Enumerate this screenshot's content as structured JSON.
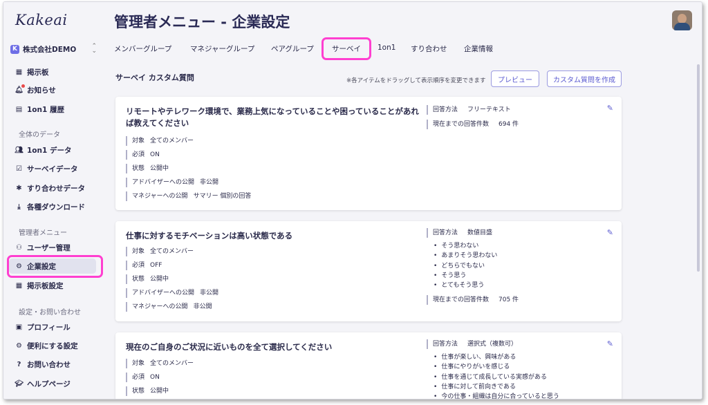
{
  "sidebar": {
    "logo": "Kakeai",
    "company": "株式会社DEMO",
    "items_top": [
      {
        "label": "掲示板",
        "icon": "board-icon"
      },
      {
        "label": "お知らせ",
        "icon": "bell-icon"
      },
      {
        "label": "1on1 履歴",
        "icon": "history-icon"
      }
    ],
    "section_data": "全体のデータ",
    "items_data": [
      {
        "label": "1on1 データ",
        "icon": "people-icon"
      },
      {
        "label": "サーベイデータ",
        "icon": "survey-icon"
      },
      {
        "label": "すり合わせデータ",
        "icon": "puzzle-icon"
      },
      {
        "label": "各種ダウンロード",
        "icon": "download-icon"
      }
    ],
    "section_admin": "管理者メニュー",
    "items_admin": [
      {
        "label": "ユーザー管理",
        "icon": "user-manage-icon"
      },
      {
        "label": "企業設定",
        "icon": "company-settings-icon",
        "active": true
      },
      {
        "label": "掲示板設定",
        "icon": "board-settings-icon"
      }
    ],
    "section_settings": "設定・お問い合わせ",
    "items_settings": [
      {
        "label": "プロフィール",
        "icon": "profile-icon"
      },
      {
        "label": "便利にする設定",
        "icon": "gear-icon"
      },
      {
        "label": "お問い合わせ",
        "icon": "help-circle-icon"
      },
      {
        "label": "ヘルプページ",
        "icon": "graduation-cap-icon"
      }
    ]
  },
  "page_title": "管理者メニュー - 企業設定",
  "tabs": [
    "メンバーグループ",
    "マネジャーグループ",
    "ペアグループ",
    "サーベイ",
    "1on1",
    "すり合わせ",
    "企業情報"
  ],
  "active_tab": "サーベイ",
  "section_title": "サーベイ カスタム質問",
  "drag_hint": "※各アイテムをドラッグして表示順序を変更できます",
  "buttons": {
    "preview": "プレビュー",
    "create": "カスタム質問を作成"
  },
  "questions": [
    {
      "text": "リモートやテレワーク環境で、業務上気になっていることや困っていることがあれば教えてください",
      "attrs": [
        {
          "k": "対象",
          "v": "全てのメンバー"
        },
        {
          "k": "必須",
          "v": "ON"
        },
        {
          "k": "状態",
          "v": "公開中"
        },
        {
          "k": "アドバイザーへの公開",
          "v": "非公開"
        },
        {
          "k": "マネジャーへの公開",
          "v": "サマリー 個別の回答"
        }
      ],
      "answer_type_k": "回答方法",
      "answer_type": "フリーテキスト",
      "options": [],
      "count_k": "現在までの回答件数",
      "count": "694 件"
    },
    {
      "text": "仕事に対するモチベーションは高い状態である",
      "attrs": [
        {
          "k": "対象",
          "v": "全てのメンバー"
        },
        {
          "k": "必須",
          "v": "OFF"
        },
        {
          "k": "状態",
          "v": "公開中"
        },
        {
          "k": "アドバイザーへの公開",
          "v": "非公開"
        },
        {
          "k": "マネジャーへの公開",
          "v": "非公開"
        }
      ],
      "answer_type_k": "回答方法",
      "answer_type": "数値目盛",
      "options": [
        "そう思わない",
        "あまりそう思わない",
        "どちらでもない",
        "そう思う",
        "とてもそう思う"
      ],
      "count_k": "現在までの回答件数",
      "count": "705 件"
    },
    {
      "text": "現在のご自身のご状況に近いものを全て選択してください",
      "attrs": [
        {
          "k": "対象",
          "v": "全てのメンバー"
        },
        {
          "k": "必須",
          "v": "ON"
        },
        {
          "k": "状態",
          "v": "公開中"
        }
      ],
      "answer_type_k": "回答方法",
      "answer_type": "選択式（複数可）",
      "options": [
        "仕事が楽しい、興味がある",
        "仕事にやりがいを感じる",
        "仕事を通じて成長している実感がある",
        "仕事に対して前向きである",
        "今の仕事・組織は自分に合っていると思う"
      ],
      "count_k": "",
      "count": ""
    }
  ]
}
